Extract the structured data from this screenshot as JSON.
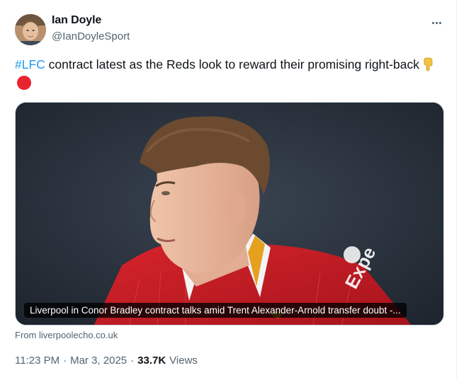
{
  "author": {
    "name": "Ian Doyle",
    "handle": "@IanDoyleSport"
  },
  "tweet": {
    "hashtag": "#LFC",
    "text": " contract latest as the Reds look to reward their promising right-back"
  },
  "media": {
    "caption": "Liverpool in Conor Bradley contract talks amid Trent Alexander-Arnold transfer doubt -...",
    "source": "From liverpoolecho.co.uk"
  },
  "meta": {
    "time": "11:23 PM",
    "separator": "·",
    "date": "Mar 3, 2025",
    "views_count": "33.7K",
    "views_label": "Views"
  },
  "colors": {
    "link": "#1d9bf0",
    "muted": "#536471",
    "text": "#0f1419",
    "red_circle": "#e8242e"
  },
  "icons": [
    "more-icon",
    "backhand-pointing-down-emoji",
    "red-circle-emoji"
  ]
}
